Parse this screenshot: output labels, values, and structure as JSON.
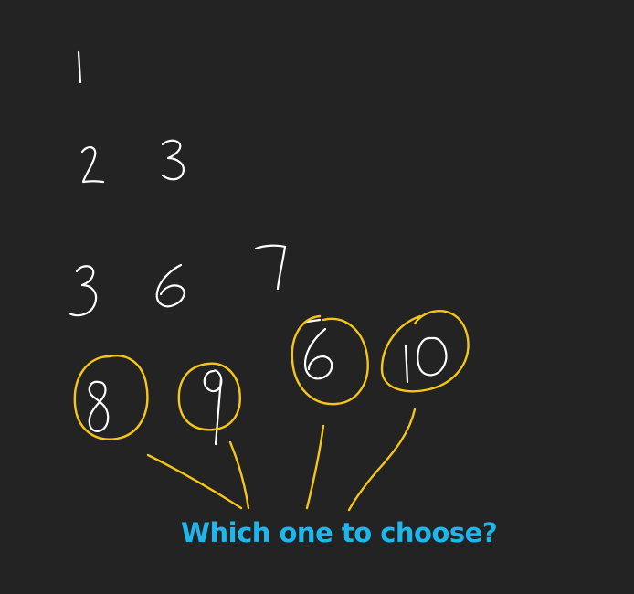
{
  "sketch": {
    "rows": [
      [
        "1"
      ],
      [
        "2",
        "3"
      ],
      [
        "3",
        "6",
        "7"
      ],
      [
        "8",
        "9",
        "6",
        "10"
      ]
    ],
    "circled_values": [
      "8",
      "9",
      "6",
      "10"
    ],
    "caption": "Which one to choose?"
  },
  "colors": {
    "background": "#232323",
    "ink": "#ffffff",
    "highlight": "#f5c518",
    "caption": "#1fb6ee"
  }
}
